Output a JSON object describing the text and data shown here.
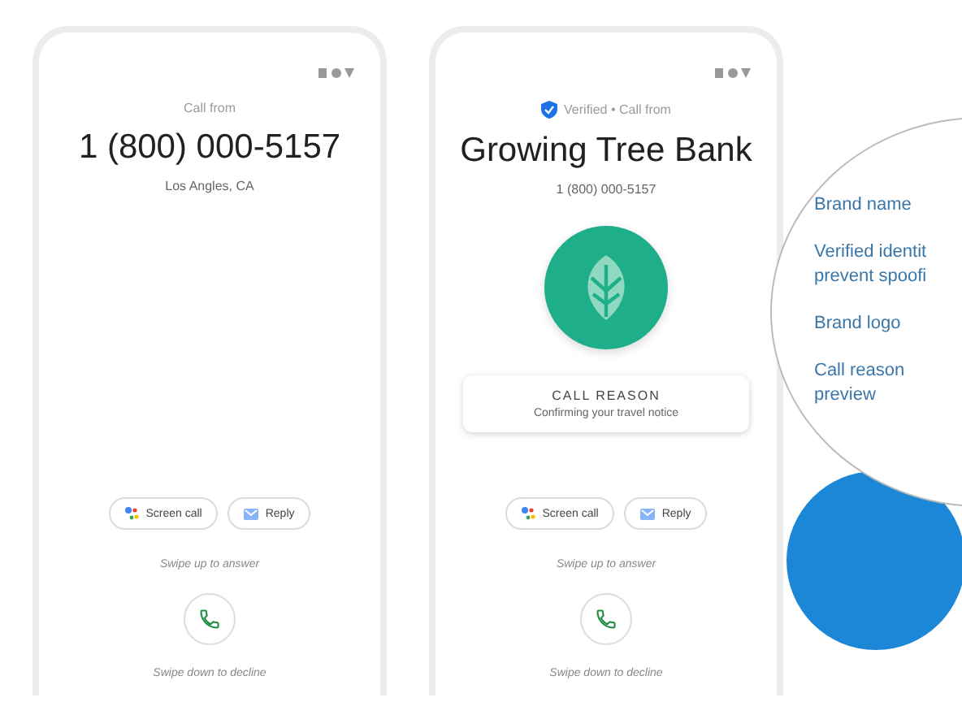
{
  "phones": [
    {
      "kind": "plain",
      "caption": "Call from",
      "title": "1 (800) 000-5157",
      "subtitle": "Los Angles, CA",
      "actions": [
        {
          "kind": "assistant",
          "label": "Screen call"
        },
        {
          "kind": "message",
          "label": "Reply"
        }
      ],
      "answer_hint": "Swipe up to answer",
      "decline_hint": "Swipe down to decline"
    },
    {
      "kind": "verified",
      "caption": "Verified • Call from",
      "title": "Growing Tree Bank",
      "subtitle": "1 (800) 000-5157",
      "call_reason": {
        "heading": "CALL REASON",
        "text": "Confirming your travel notice"
      },
      "actions": [
        {
          "kind": "assistant",
          "label": "Screen call"
        },
        {
          "kind": "message",
          "label": "Reply"
        }
      ],
      "answer_hint": "Swipe up to answer",
      "decline_hint": "Swipe down to decline"
    }
  ],
  "callouts": [
    {
      "lines": [
        "Brand name"
      ]
    },
    {
      "lines": [
        "Verified identit",
        "prevent spoofi"
      ]
    },
    {
      "lines": [
        "Brand logo"
      ]
    },
    {
      "lines": [
        "Call reason",
        "preview"
      ]
    }
  ]
}
